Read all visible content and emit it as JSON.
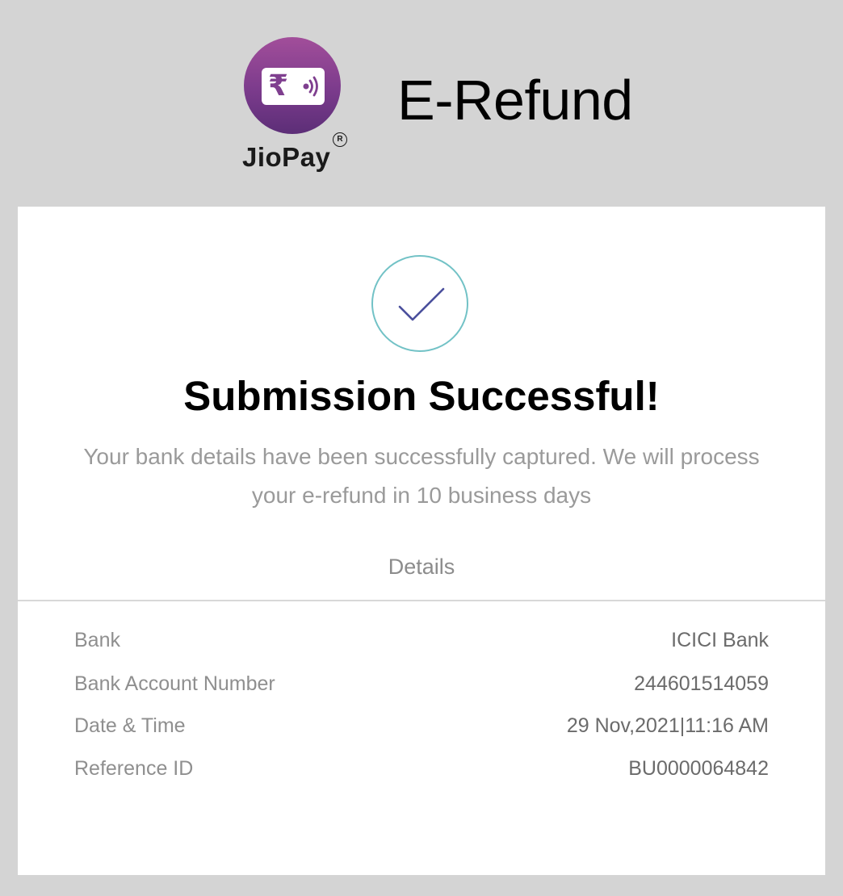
{
  "header": {
    "logo_text": "JioPay",
    "logo_symbol": "₹",
    "registered_mark": "R",
    "title": "E-Refund"
  },
  "confirmation": {
    "icon": "checkmark-icon",
    "title": "Submission Successful!",
    "message": "Your bank details have been successfully captured. We will process your e-refund in 10 business days"
  },
  "details": {
    "heading": "Details",
    "rows": [
      {
        "label": "Bank",
        "value": "ICICI Bank"
      },
      {
        "label": "Bank Account Number",
        "value": "244601514059"
      },
      {
        "label": "Date & Time",
        "value": "29 Nov,2021|11:16 AM"
      },
      {
        "label": "Reference ID",
        "value": "BU0000064842"
      }
    ]
  },
  "colors": {
    "background": "#d4d4d4",
    "card": "#ffffff",
    "logo_purple": "#7b3b8c",
    "check_ring": "#72c2c6",
    "check_mark": "#4a4f9c"
  }
}
